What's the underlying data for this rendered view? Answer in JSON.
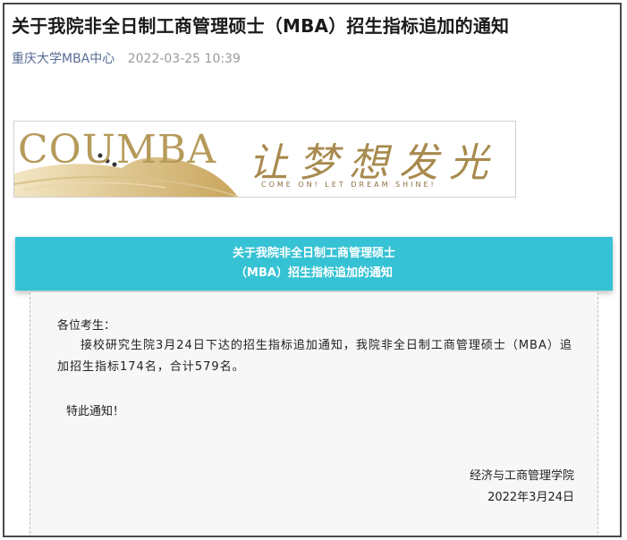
{
  "article": {
    "title": "关于我院非全日制工商管理硕士（MBA）招生指标追加的通知",
    "source": "重庆大学MBA中心",
    "date": "2022-03-25 10:39"
  },
  "banner": {
    "logo": "COUMBA",
    "slogan": "让梦想发光",
    "slogan_en": "COME ON! LET DREAM SHINE!"
  },
  "notice": {
    "heading_line1": "关于我院非全日制工商管理硕士",
    "heading_line2": "（MBA）招生指标追加的通知",
    "greeting": "各位考生：",
    "paragraph": "接校研究生院3月24日下达的招生指标追加通知，我院非全日制工商管理硕士（MBA）追加招生指标174名，合计579名。",
    "closing": "特此通知！",
    "signature_org": "经济与工商管理学院",
    "signature_date": "2022年3月24日"
  },
  "colors": {
    "heading_bg": "#35c2d4",
    "source_link": "#576b95",
    "gold": "#b59a5a"
  }
}
